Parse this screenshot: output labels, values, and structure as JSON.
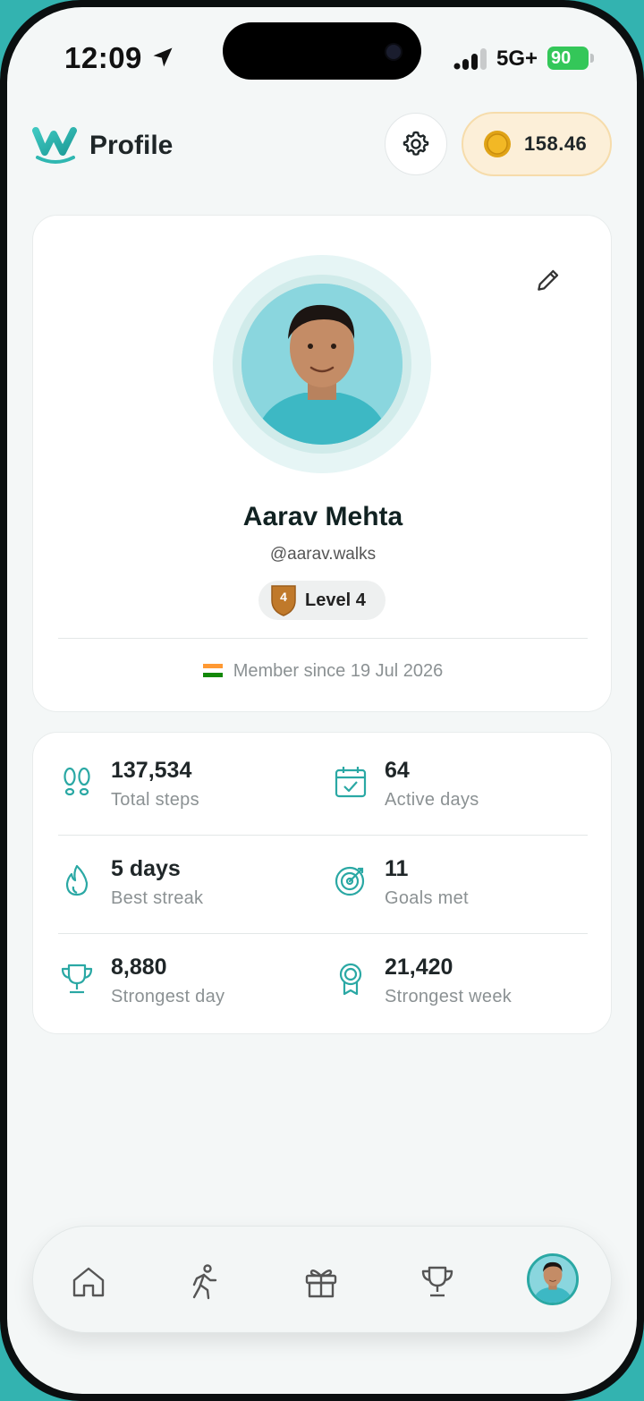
{
  "status_bar": {
    "time": "12:09",
    "network": "5G+",
    "battery": "90"
  },
  "header": {
    "title": "Profile",
    "coin_balance": "158.46"
  },
  "profile": {
    "name": "Aarav Mehta",
    "handle": "@aarav.walks",
    "level_number": "4",
    "level_label": "Level 4",
    "member_since": "Member since 19 Jul 2026"
  },
  "stats": [
    {
      "value": "137,534",
      "label": "Total steps",
      "icon": "footsteps-icon"
    },
    {
      "value": "64",
      "label": "Active days",
      "icon": "calendar-check-icon"
    },
    {
      "value": "5 days",
      "label": "Best streak",
      "icon": "flame-icon"
    },
    {
      "value": "11",
      "label": "Goals met",
      "icon": "target-icon"
    },
    {
      "value": "8,880",
      "label": "Strongest day",
      "icon": "trophy-icon"
    },
    {
      "value": "21,420",
      "label": "Strongest week",
      "icon": "medal-icon"
    }
  ],
  "nav": {
    "items": [
      "home-icon",
      "walking-icon",
      "gift-icon",
      "trophy-icon",
      "profile-avatar"
    ],
    "active": "profile-avatar"
  },
  "colors": {
    "accent": "#2aa8a4",
    "coin_bg": "#fcefd8",
    "level_badge": "#c0792a"
  }
}
